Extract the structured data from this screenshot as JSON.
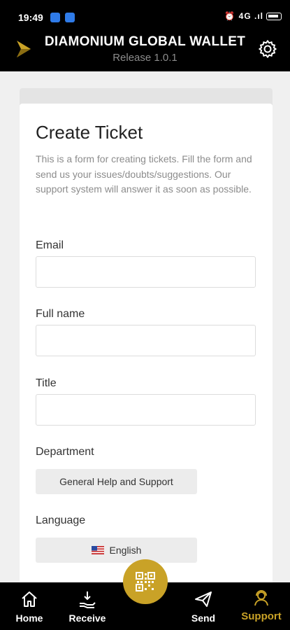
{
  "status_bar": {
    "time": "19:49",
    "right_indicators": "⏰ 4G .ıl"
  },
  "header": {
    "title": "DIAMONIUM GLOBAL WALLET",
    "version": "Release 1.0.1",
    "accent_color": "#c9a227"
  },
  "form": {
    "title": "Create Ticket",
    "description": "This is a form for creating tickets. Fill the form and send us your issues/doubts/suggestions. Our support system will answer it as soon as possible.",
    "email": {
      "label": "Email",
      "value": "",
      "placeholder": ""
    },
    "full_name": {
      "label": "Full name",
      "value": "",
      "placeholder": ""
    },
    "title_field": {
      "label": "Title",
      "value": "",
      "placeholder": ""
    },
    "department": {
      "label": "Department",
      "selected": "General Help and Support"
    },
    "language": {
      "label": "Language",
      "selected": "English",
      "flag_icon": "us-flag-icon"
    }
  },
  "bottom_nav": {
    "items": [
      {
        "label": "Home",
        "icon": "home-icon",
        "active": false
      },
      {
        "label": "Receive",
        "icon": "receive-icon",
        "active": false
      },
      {
        "label": "Send",
        "icon": "send-icon",
        "active": false
      },
      {
        "label": "Support",
        "icon": "support-icon",
        "active": true
      }
    ],
    "fab_icon": "qr-code-icon"
  }
}
